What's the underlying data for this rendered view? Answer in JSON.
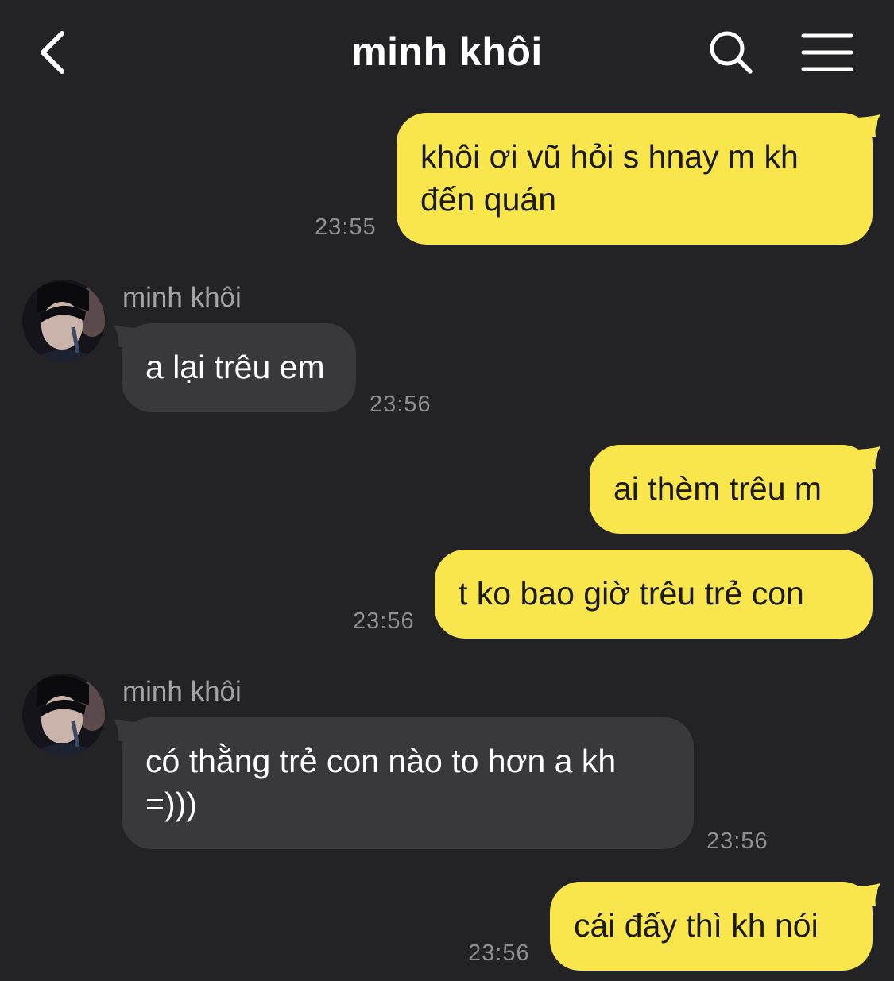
{
  "header": {
    "title": "minh khôi",
    "back_icon": "chevron-left-icon",
    "search_icon": "search-icon",
    "menu_icon": "hamburger-menu-icon"
  },
  "colors": {
    "background": "#232325",
    "outgoing_bubble": "#f9e54c",
    "incoming_bubble": "#39393b",
    "timestamp": "#8e8e93"
  },
  "messages": [
    {
      "direction": "out",
      "text": "khôi ơi vũ hỏi s hnay m kh đến quán",
      "time": "23:55"
    },
    {
      "direction": "in",
      "sender": "minh khôi",
      "text": "a lại trêu em",
      "time": "23:56"
    },
    {
      "direction": "out",
      "text": "ai thèm trêu m",
      "time": ""
    },
    {
      "direction": "out",
      "text": "t ko bao giờ trêu trẻ con",
      "time": "23:56"
    },
    {
      "direction": "in",
      "sender": "minh khôi",
      "text": "có thằng trẻ con nào to hơn a kh =)))",
      "time": "23:56"
    },
    {
      "direction": "out",
      "text": "cái đấy thì kh nói",
      "time": "23:56"
    }
  ]
}
